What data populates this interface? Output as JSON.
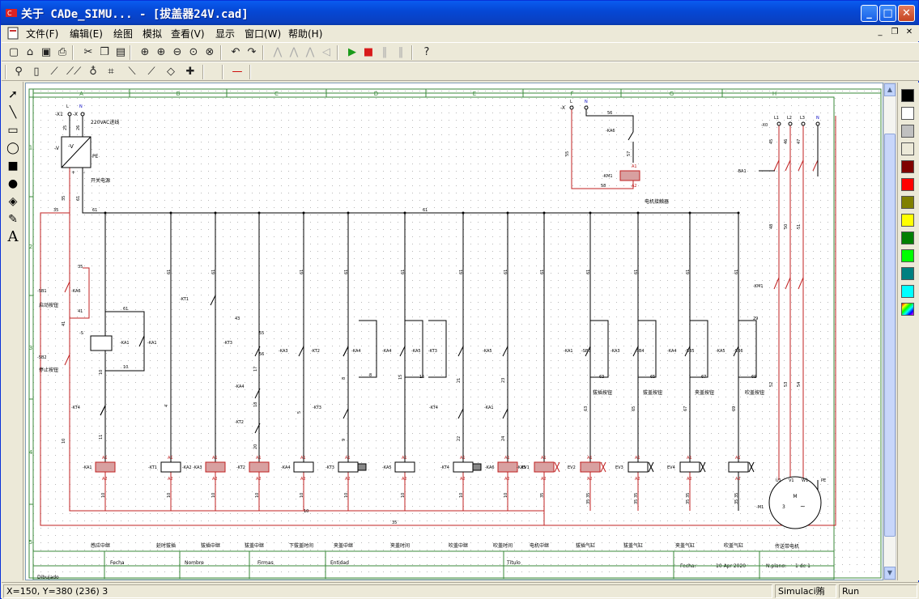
{
  "window": {
    "title": "关于 CADe_SIMU... - [拔盖器24V.cad]",
    "controls": {
      "minimize": "_",
      "maximize": "□",
      "close": "✕"
    }
  },
  "menu": [
    {
      "label": "文件(F)"
    },
    {
      "label": "编辑(E)"
    },
    {
      "label": "绘图"
    },
    {
      "label": "模拟"
    },
    {
      "label": "查看(V)"
    },
    {
      "label": "显示"
    },
    {
      "label": "窗口(W)"
    },
    {
      "label": "帮助(H)"
    }
  ],
  "mdi_controls": {
    "minimize": "_",
    "restore": "❐",
    "close": "✕"
  },
  "toolbar1": [
    {
      "name": "new",
      "glyph": "▢"
    },
    {
      "name": "open",
      "glyph": "⌂"
    },
    {
      "name": "save",
      "glyph": "▣"
    },
    {
      "name": "print",
      "glyph": "⎙"
    },
    {
      "name": "cut",
      "glyph": "✂"
    },
    {
      "name": "copy",
      "glyph": "❐"
    },
    {
      "name": "paste",
      "glyph": "▤"
    },
    {
      "name": "zoom-page",
      "glyph": "⊕"
    },
    {
      "name": "zoom-in",
      "glyph": "⊕"
    },
    {
      "name": "zoom-out",
      "glyph": "⊖"
    },
    {
      "name": "zoom-window",
      "glyph": "⊙"
    },
    {
      "name": "zoom-prev",
      "glyph": "⊗"
    },
    {
      "name": "undo",
      "glyph": "↶"
    },
    {
      "name": "redo",
      "glyph": "↷"
    },
    {
      "name": "mirror-1",
      "glyph": "⋀"
    },
    {
      "name": "mirror-2",
      "glyph": "⋀"
    },
    {
      "name": "mirror-3",
      "glyph": "⋀"
    },
    {
      "name": "mirror-4",
      "glyph": "◁"
    },
    {
      "name": "play",
      "glyph": "▶"
    },
    {
      "name": "stop",
      "glyph": "■"
    },
    {
      "name": "pause",
      "glyph": "‖"
    },
    {
      "name": "step",
      "glyph": "‖"
    },
    {
      "name": "help",
      "glyph": "?"
    }
  ],
  "toolbar2": [
    {
      "name": "probe",
      "glyph": "⚲"
    },
    {
      "name": "fuse",
      "glyph": "▯"
    },
    {
      "name": "contact",
      "glyph": "⟋"
    },
    {
      "name": "multi-contact",
      "glyph": "⟋⟋"
    },
    {
      "name": "motor",
      "glyph": "♁"
    },
    {
      "name": "coil",
      "glyph": "⌗"
    },
    {
      "name": "switch-1",
      "glyph": "⟍"
    },
    {
      "name": "switch-2",
      "glyph": "⟋"
    },
    {
      "name": "terminal",
      "glyph": "◇"
    },
    {
      "name": "cross",
      "glyph": "✚"
    },
    {
      "name": "line-red",
      "glyph": "—"
    }
  ],
  "left_tools": [
    {
      "name": "pointer",
      "glyph": "➚"
    },
    {
      "name": "line",
      "glyph": "╲"
    },
    {
      "name": "rectangle",
      "glyph": "▭"
    },
    {
      "name": "ellipse",
      "glyph": "◯"
    },
    {
      "name": "filled-rectangle",
      "glyph": "■"
    },
    {
      "name": "filled-ellipse",
      "glyph": "●"
    },
    {
      "name": "fill",
      "glyph": "◈"
    },
    {
      "name": "pen",
      "glyph": "✎"
    },
    {
      "name": "text",
      "glyph": "A"
    }
  ],
  "palette": [
    "#000000",
    "#ffffff",
    "#c0c0c0",
    "#ece9d8",
    "#800000",
    "#ff0000",
    "#808000",
    "#ffff00",
    "#008000",
    "#00ff00",
    "#008080",
    "#00ffff",
    "rainbow"
  ],
  "status": {
    "coords": "X=150, Y=380 (236) 3",
    "mode": "Simulaci贿",
    "run": "Run"
  },
  "schematic": {
    "columns": [
      "A",
      "B",
      "C",
      "D",
      "E",
      "F",
      "G",
      "H"
    ],
    "rows": [
      "1",
      "2",
      "3",
      "4",
      "5"
    ],
    "top": {
      "terminal_x1": "-X1",
      "terminal_x": "-X",
      "L": "L",
      "N": "N",
      "supply_label": "220VAC进线",
      "psu": "-V",
      "pe": "PE",
      "psu_caption": "开关电源",
      "wire_25": "25",
      "wire_26": "26",
      "plus": "+",
      "minus": "-",
      "wire_35": "35",
      "wire_61": "61",
      "bus_61": "61",
      "bus_35": "35"
    },
    "km_group": {
      "terminal": "-X",
      "L": "L",
      "N": "N",
      "w56": "56",
      "ka6": "-KA6",
      "w55": "55",
      "w57": "57",
      "km1": "-KM1",
      "a1": "A1",
      "a2": "A2",
      "w58": "58",
      "caption": "电机接触器"
    },
    "motor_group": {
      "terminal": "-X0",
      "L1": "L1",
      "L2": "L2",
      "L3": "L3",
      "N": "N",
      "w45": "45",
      "w46": "46",
      "w47": "47",
      "ba1": "-BA1",
      "w48": "48",
      "w50": "50",
      "w51": "51",
      "km1": "-KM1",
      "w52": "52",
      "w53": "53",
      "w54": "54",
      "u1": "U1",
      "v1": "V1",
      "w1": "W1",
      "pe": "PE",
      "m": "M",
      "three": "3",
      "tilde": "~",
      "m1": "-M1",
      "caption": "传送带电机"
    },
    "left_circuit": {
      "sb1": "-SB1",
      "ka6": "-KA6",
      "start": "启动按钮",
      "w41a": "41",
      "w41b": "41",
      "w35": "35",
      "sb2": "-SB2",
      "stop": "停止按钮",
      "s": "-S",
      "ka1a": "-KA1",
      "ka1b": "-KA1",
      "w10a": "10",
      "w10b": "10",
      "w61": "61",
      "kt4": "-KT4",
      "w11": "11",
      "w10c": "10"
    },
    "coils": [
      {
        "ref": "-KA1",
        "fn": "感应中继",
        "a1": "A1",
        "a2": "A2",
        "wire": "10"
      },
      {
        "ref": "-KT1",
        "fn": "延时拔插",
        "a1": "A1",
        "a2": "A2",
        "wire": "10",
        "extra": "-KA2"
      },
      {
        "ref": "-KA3",
        "fn": "拔插中继",
        "a1": "A1",
        "a2": "A2",
        "wire": "10"
      },
      {
        "ref": "-KT2",
        "fn": "拔盖中继",
        "a1": "A1",
        "a2": "A2",
        "wire": "10"
      },
      {
        "ref": "-KA4",
        "fn": "下拔盖时间",
        "a1": "A1",
        "a2": "A2",
        "wire": "10"
      },
      {
        "ref": "-KT3",
        "fn": "夹盖中继",
        "a1": "A1",
        "a2": "A2",
        "wire": "10"
      },
      {
        "ref": "-KA5",
        "fn": "夹盖时间",
        "a1": "A1",
        "a2": "A2",
        "wire": "10"
      },
      {
        "ref": "-KT4",
        "fn": "吹盖中继",
        "a1": "A1",
        "a2": "A2",
        "wire": "10"
      },
      {
        "ref": "-KA6",
        "fn": "吹盖时间",
        "a1": "A1",
        "a2": "A2",
        "wire": "10"
      },
      {
        "ref": "EV1",
        "fn": "电机中继",
        "a1": "A1",
        "a2": "A2",
        "wire": "35"
      },
      {
        "ref": "EV2",
        "fn": "拔插气缸",
        "a1": "A1",
        "a2": "A2",
        "wire": "35"
      },
      {
        "ref": "EV3",
        "fn": "拔盖气缸",
        "a1": "A1",
        "a2": "A2",
        "wire": "35"
      },
      {
        "ref": "EV4",
        "fn": "夹盖气缸",
        "a1": "A1",
        "a2": "A2",
        "wire": "35"
      },
      {
        "ref": "",
        "fn": "吹盖气缸",
        "a1": "A1",
        "a2": "A2",
        "wire": "35"
      }
    ],
    "branch_labels": {
      "kt1": "-KT1",
      "w43": "43",
      "w55": "55",
      "w56": "56",
      "kt3a": "-KT3",
      "w17": "17",
      "ka4a": "-KA4",
      "w18": "18",
      "kt2a": "-KT2",
      "w20": "20",
      "w4": "4",
      "w5": "5",
      "ka3": "-KA3",
      "kt2b": "-KT2",
      "kt3b": "-KT3",
      "w9": "9",
      "ka4b": "-KA4",
      "ka4c": "-KA4",
      "w8a": "8",
      "w8b": "8",
      "ka5a": "-KA5",
      "kt3c": "-KT3",
      "w15a": "15",
      "w15b": "15",
      "ka5b": "-KA5",
      "w21": "21",
      "kt4": "-KT4",
      "w22": "22",
      "ka1": "-KA1",
      "w23": "23",
      "w24": "24",
      "ka5c": "-KA5",
      "ka1b": "-KA1",
      "sb3": "-SB3",
      "ka3b": "-KA3",
      "w63a": "63",
      "w63b": "63",
      "ka4d": "-KA4",
      "sb4": "-SB4",
      "w65a": "65",
      "w65b": "65",
      "sb5": "-SB5",
      "ka5d": "-KA5",
      "w67a": "67",
      "w67b": "67",
      "sb6": "-SB6",
      "w69a": "69",
      "w69b": "69",
      "w29": "29",
      "btn3": "拔插按钮",
      "btn4": "拔盖按钮",
      "btn5": "夹盖按钮",
      "btn6": "吹盖按钮",
      "w61": "61",
      "w35": "35",
      "w10": "10"
    },
    "titleblock": {
      "fecha": "Fecha",
      "nombre": "Nombre",
      "firmas": "Firmas",
      "entidad": "Entidad",
      "titulo": "Título",
      "fecha2": "Fecha:",
      "date": "10-Apr-2020",
      "nplano": "N.plano:",
      "sheet": "1 de 1",
      "dibujado": "Dibujado"
    }
  }
}
